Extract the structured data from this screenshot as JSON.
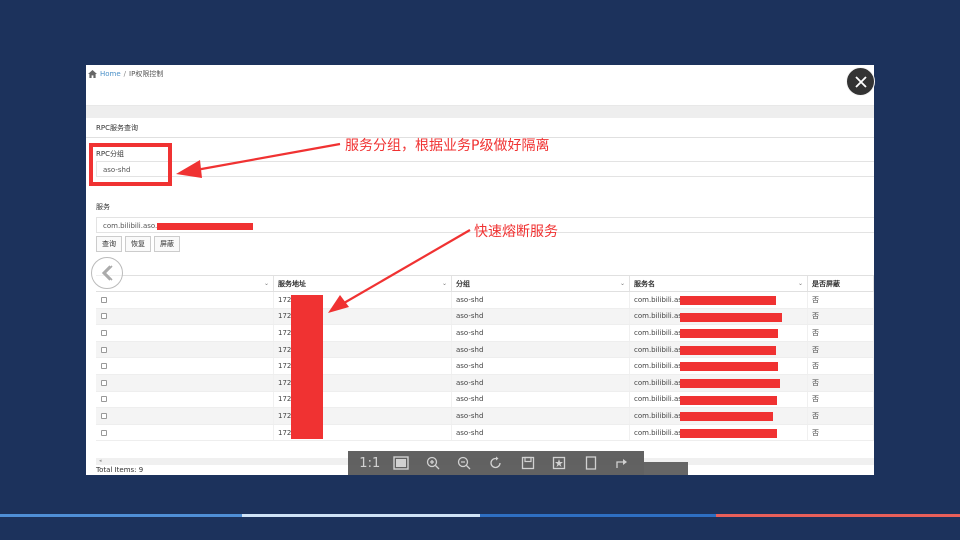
{
  "breadcrumb": {
    "home": "Home",
    "separator": "/",
    "current": "IP权限控制"
  },
  "panel": {
    "title": "RPC服务查询"
  },
  "group": {
    "label": "RPC分组",
    "value": "aso-shd"
  },
  "service": {
    "label": "服务",
    "value": "com.bilibili.aso."
  },
  "buttons": {
    "query": "查询",
    "restore": "恢复",
    "block": "屏蔽"
  },
  "table": {
    "headers": [
      "",
      "服务地址",
      "分组",
      "服务名",
      "是否屏蔽"
    ],
    "rows": [
      {
        "address": "172.",
        "group": "aso-shd",
        "name": "com.bilibili.aso",
        "blocked": "否"
      },
      {
        "address": "172.",
        "group": "aso-shd",
        "name": "com.bilibili.aso",
        "blocked": "否"
      },
      {
        "address": "172.",
        "group": "aso-shd",
        "name": "com.bilibili.aso",
        "blocked": "否"
      },
      {
        "address": "172.",
        "group": "aso-shd",
        "name": "com.bilibili.aso",
        "blocked": "否"
      },
      {
        "address": "172.",
        "group": "aso-shd",
        "name": "com.bilibili.aso",
        "blocked": "否"
      },
      {
        "address": "172.",
        "group": "aso-shd",
        "name": "com.bilibili.aso.",
        "blocked": "否"
      },
      {
        "address": "172.",
        "group": "aso-shd",
        "name": "com.bilibili.aso",
        "blocked": "否"
      },
      {
        "address": "172.",
        "group": "aso-shd",
        "name": "com.bilibili.aso",
        "blocked": "否"
      },
      {
        "address": "172.",
        "group": "aso-shd",
        "name": "com.bilibili.aso",
        "blocked": "否"
      }
    ],
    "total": "Total Items: 9"
  },
  "annotations": {
    "group_note": "服务分组，根据业务P级做好隔离",
    "breaker_note": "快速熔断服务"
  },
  "viewer": {
    "zoom_reset": "1:1"
  },
  "colors": {
    "background": "#1c325c",
    "annotation": "#f03232",
    "link": "#4a90c8"
  },
  "icons": [
    "home-icon",
    "close-icon",
    "back-arrow-icon",
    "zoom-in-icon",
    "zoom-out-icon",
    "rotate-icon",
    "save-icon",
    "fit-icon",
    "share-icon"
  ]
}
